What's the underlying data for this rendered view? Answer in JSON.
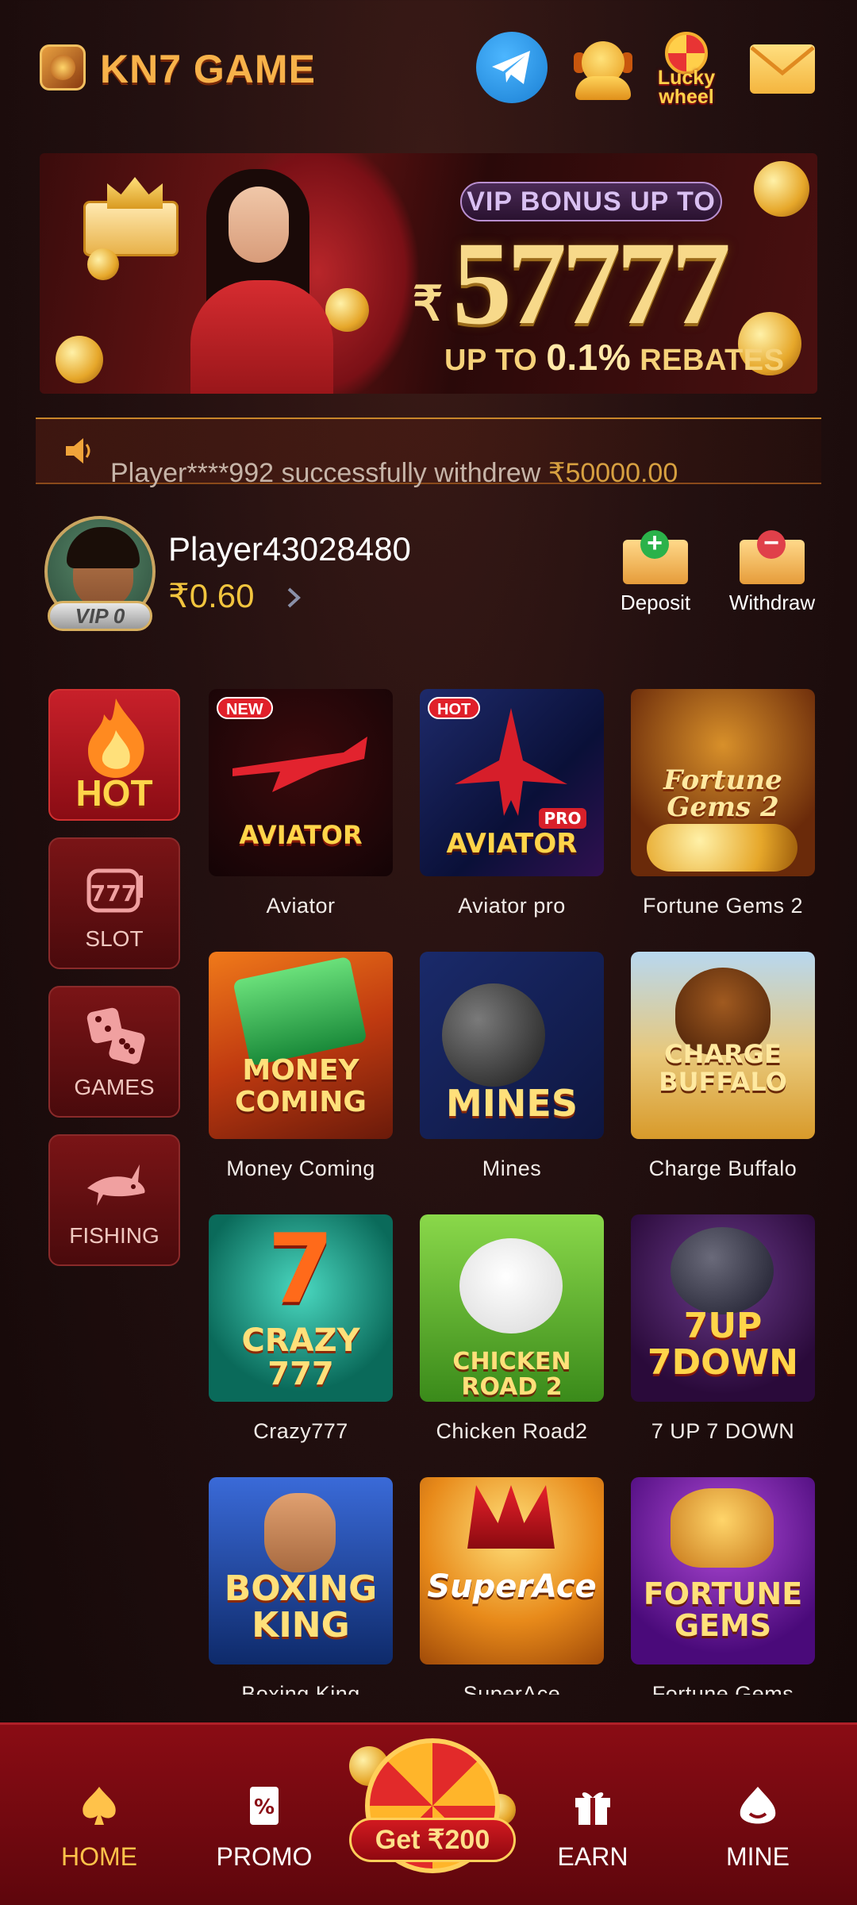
{
  "header": {
    "brand": "KN7 GAME",
    "lucky_wheel": "Lucky\nwheel"
  },
  "banner": {
    "tagline": "VIP BONUS UP TO",
    "currency": "₹",
    "amount": "57777",
    "rebate_prefix": "UP TO",
    "rebate_pct": "0.1%",
    "rebate_suffix": "REBATES"
  },
  "marquee": {
    "text": "Player****992 successfully withdrew",
    "amount": "₹50000.00"
  },
  "player": {
    "vip": "VIP 0",
    "name": "Player43028480",
    "balance": "₹0.60",
    "deposit_label": "Deposit",
    "withdraw_label": "Withdraw"
  },
  "categories": [
    {
      "label": "HOT",
      "active": true
    },
    {
      "label": "SLOT"
    },
    {
      "label": "GAMES"
    },
    {
      "label": "FISHING"
    }
  ],
  "games": [
    {
      "name": "Aviator",
      "tile_text": "AVIATOR",
      "tag": "NEW"
    },
    {
      "name": "Aviator pro",
      "tile_text": "AVIATOR",
      "sub_text": "PRO",
      "tag": "HOT"
    },
    {
      "name": "Fortune Gems 2",
      "tile_text": "Fortune Gems 2"
    },
    {
      "name": "Money Coming",
      "tile_text": "MONEY COMING"
    },
    {
      "name": "Mines",
      "tile_text": "MINES"
    },
    {
      "name": "Charge Buffalo",
      "tile_text": "CHARGE BUFFALO"
    },
    {
      "name": "Crazy777",
      "tile_text": "CRAZY 777"
    },
    {
      "name": "Chicken Road2",
      "tile_text": "CHICKEN ROAD 2"
    },
    {
      "name": "7 UP 7 DOWN",
      "tile_text": "7UP 7DOWN"
    },
    {
      "name": "Boxing King",
      "tile_text": "BOXING KING"
    },
    {
      "name": "SuperAce",
      "tile_text": "SuperAce"
    },
    {
      "name": "Fortune Gems",
      "tile_text": "FORTUNE GEMS"
    }
  ],
  "nav": {
    "home": "HOME",
    "promo": "PROMO",
    "spin": "Get ₹200",
    "earn": "EARN",
    "mine": "MINE"
  },
  "colors": {
    "accent": "#f7b24a",
    "nav_bg": "#8a0c14",
    "active_nav": "#ffc24a"
  }
}
